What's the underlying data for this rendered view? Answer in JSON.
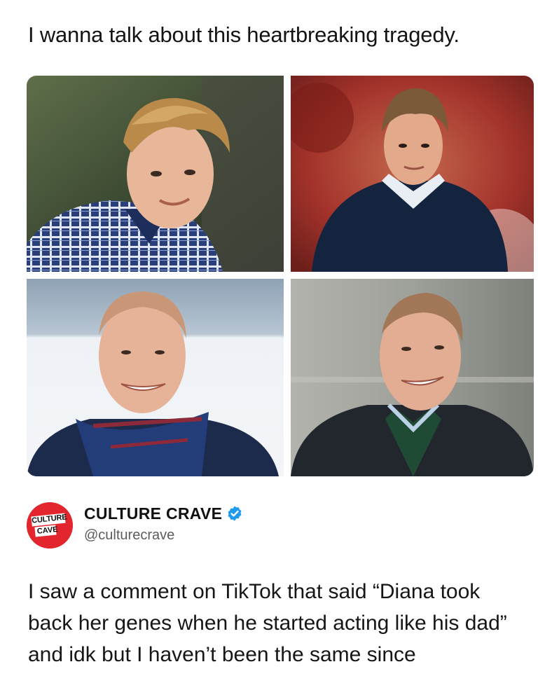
{
  "headline": "I wanna talk about this heartbreaking tragedy.",
  "photos": [
    {
      "icon": "photo-young-blond-plaid-shirt"
    },
    {
      "icon": "photo-young-dark-sweater-red-background"
    },
    {
      "icon": "photo-bald-smiling-navy-scarf"
    },
    {
      "icon": "photo-bald-smiling-dark-jacket"
    }
  ],
  "author": {
    "avatar_line1": "CULTURE",
    "avatar_line2": "CAVE",
    "name": "CULTURE CRAVE",
    "handle": "@culturecrave",
    "avatar_color": "#e3262e",
    "verified_color": "#1d9bf0"
  },
  "body": {
    "line1": "I saw a comment on TikTok that said “Diana took",
    "line2": "back her genes when he started acting like his dad”",
    "line3": "and idk but I haven’t been the same since"
  }
}
